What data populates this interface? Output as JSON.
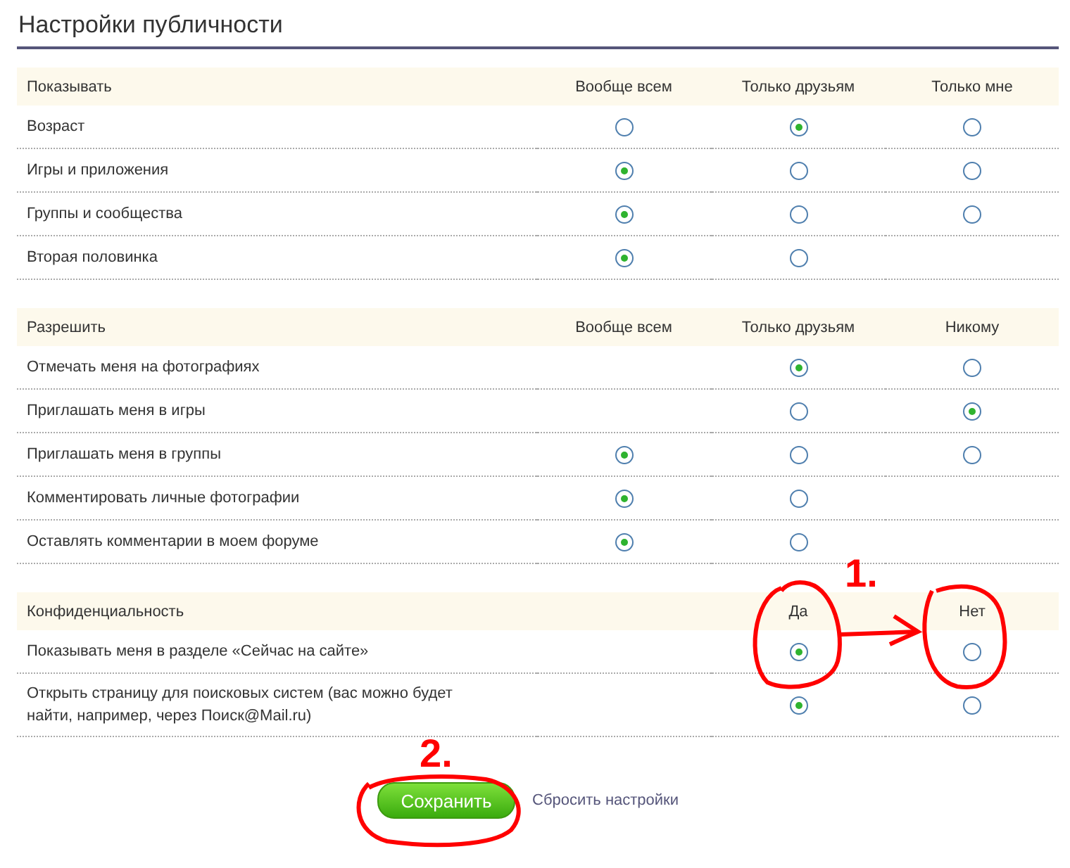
{
  "title": "Настройки публичности",
  "sections": [
    {
      "heading": "Показывать",
      "columns": [
        {
          "kind": "label",
          "text": "Вообще всем"
        },
        {
          "kind": "label",
          "text": "Только друзьям"
        },
        {
          "kind": "label",
          "text": "Только мне"
        }
      ],
      "rows": [
        {
          "label": "Возраст",
          "options": [
            {
              "kind": "radio",
              "selected": false
            },
            {
              "kind": "radio",
              "selected": true
            },
            {
              "kind": "radio",
              "selected": false
            }
          ]
        },
        {
          "label": "Игры и приложения",
          "options": [
            {
              "kind": "radio",
              "selected": true
            },
            {
              "kind": "radio",
              "selected": false
            },
            {
              "kind": "radio",
              "selected": false
            }
          ]
        },
        {
          "label": "Группы и сообщества",
          "options": [
            {
              "kind": "radio",
              "selected": true
            },
            {
              "kind": "radio",
              "selected": false
            },
            {
              "kind": "radio",
              "selected": false
            }
          ]
        },
        {
          "label": "Вторая половинка",
          "options": [
            {
              "kind": "radio",
              "selected": true
            },
            {
              "kind": "radio",
              "selected": false
            },
            {
              "kind": "blank"
            }
          ]
        }
      ]
    },
    {
      "heading": "Разрешить",
      "columns": [
        {
          "kind": "label",
          "text": "Вообще всем"
        },
        {
          "kind": "label",
          "text": "Только друзьям"
        },
        {
          "kind": "label",
          "text": "Никому"
        }
      ],
      "rows": [
        {
          "label": "Отмечать меня на фотографиях",
          "options": [
            {
              "kind": "blank"
            },
            {
              "kind": "radio",
              "selected": true
            },
            {
              "kind": "radio",
              "selected": false
            }
          ]
        },
        {
          "label": "Приглашать меня в игры",
          "options": [
            {
              "kind": "blank"
            },
            {
              "kind": "radio",
              "selected": false
            },
            {
              "kind": "radio",
              "selected": true
            }
          ]
        },
        {
          "label": "Приглашать меня в группы",
          "options": [
            {
              "kind": "radio",
              "selected": true
            },
            {
              "kind": "radio",
              "selected": false
            },
            {
              "kind": "radio",
              "selected": false
            }
          ]
        },
        {
          "label": "Комментировать личные фотографии",
          "options": [
            {
              "kind": "radio",
              "selected": true
            },
            {
              "kind": "radio",
              "selected": false
            },
            {
              "kind": "blank"
            }
          ]
        },
        {
          "label": "Оставлять комментарии в моем форуме",
          "options": [
            {
              "kind": "radio",
              "selected": true
            },
            {
              "kind": "radio",
              "selected": false
            },
            {
              "kind": "blank"
            }
          ]
        }
      ]
    },
    {
      "heading": "Конфиденциальность",
      "columns": [
        {
          "kind": "blank"
        },
        {
          "kind": "label",
          "text": "Да"
        },
        {
          "kind": "label",
          "text": "Нет"
        }
      ],
      "rows": [
        {
          "label": "Показывать меня в разделе «Сейчас на сайте»",
          "options": [
            {
              "kind": "blank"
            },
            {
              "kind": "radio",
              "selected": true
            },
            {
              "kind": "radio",
              "selected": false
            }
          ]
        },
        {
          "label": "Открыть страницу для поисковых систем (вас можно будет найти, например, через Поиск@Mail.ru)",
          "options": [
            {
              "kind": "blank"
            },
            {
              "kind": "radio",
              "selected": true
            },
            {
              "kind": "radio",
              "selected": false
            }
          ]
        }
      ]
    }
  ],
  "save_button": "Сохранить",
  "reset_link": "Сбросить настройки",
  "annotations": [
    {
      "kind": "step",
      "text": "1."
    },
    {
      "kind": "step",
      "text": "2."
    }
  ]
}
